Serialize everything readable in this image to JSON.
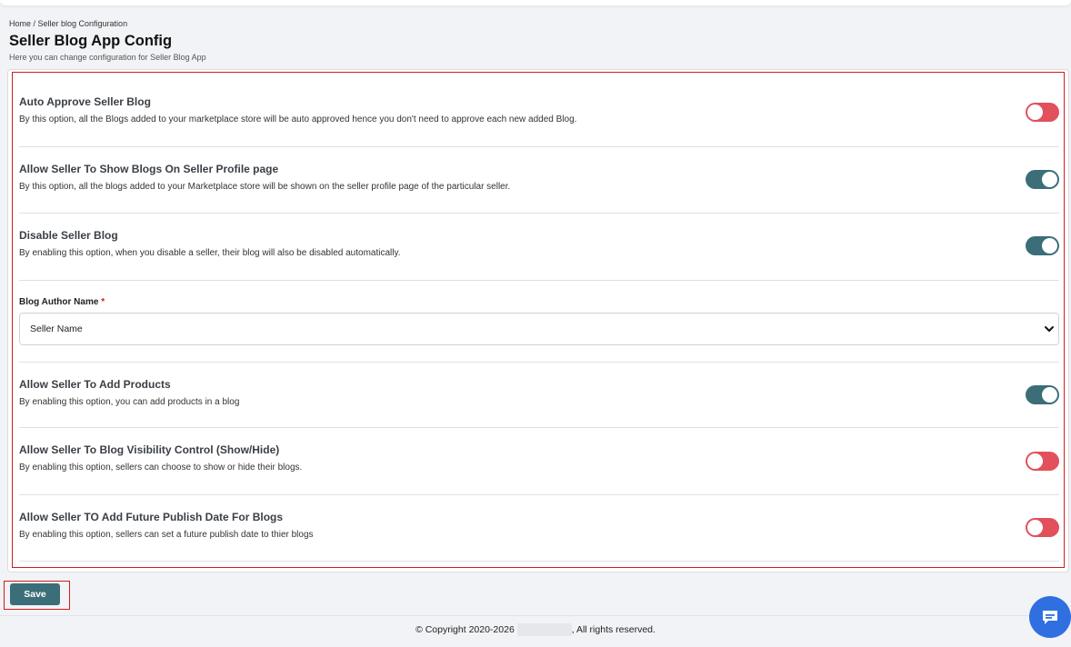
{
  "breadcrumb": "Home / Seller blog Configuration",
  "page_title": "Seller Blog App Config",
  "page_subtitle": "Here you can change configuration for Seller Blog App",
  "settings": [
    {
      "title": "Auto Approve Seller Blog",
      "description": "By this option, all the Blogs added to your marketplace store will be auto approved hence you don't need to approve each new added Blog.",
      "enabled": false
    },
    {
      "title": "Allow Seller To Show Blogs On Seller Profile page",
      "description": "By this option, all the blogs added to your Marketplace store will be shown on the seller profile page of the particular seller.",
      "enabled": true
    },
    {
      "title": "Disable Seller Blog",
      "description": "By enabling this option, when you disable a seller, their blog will also be disabled automatically.",
      "enabled": true
    },
    {
      "title": "Allow Seller To Add Products",
      "description": "By enabling this option, you can add products in a blog",
      "enabled": true
    },
    {
      "title": "Allow Seller To Blog Visibility Control (Show/Hide)",
      "description": "By enabling this option, sellers can choose to show or hide their blogs.",
      "enabled": false
    },
    {
      "title": "Allow Seller TO Add Future Publish Date For Blogs",
      "description": "By enabling this option, sellers can set a future publish date to thier blogs",
      "enabled": false
    }
  ],
  "author_field": {
    "label": "Blog Author Name",
    "required_mark": "*",
    "selected": "Seller Name"
  },
  "save_label": "Save",
  "footer": {
    "prefix": "© Copyright 2020-2026",
    "suffix": ", All rights reserved."
  },
  "colors": {
    "toggle_on": "#3b6e78",
    "toggle_off": "#e2505c",
    "highlight": "#d11a1a",
    "chat": "#2f6fe0"
  },
  "icons": {
    "select_arrow": "chevron-down-icon",
    "chat": "chat-icon"
  }
}
